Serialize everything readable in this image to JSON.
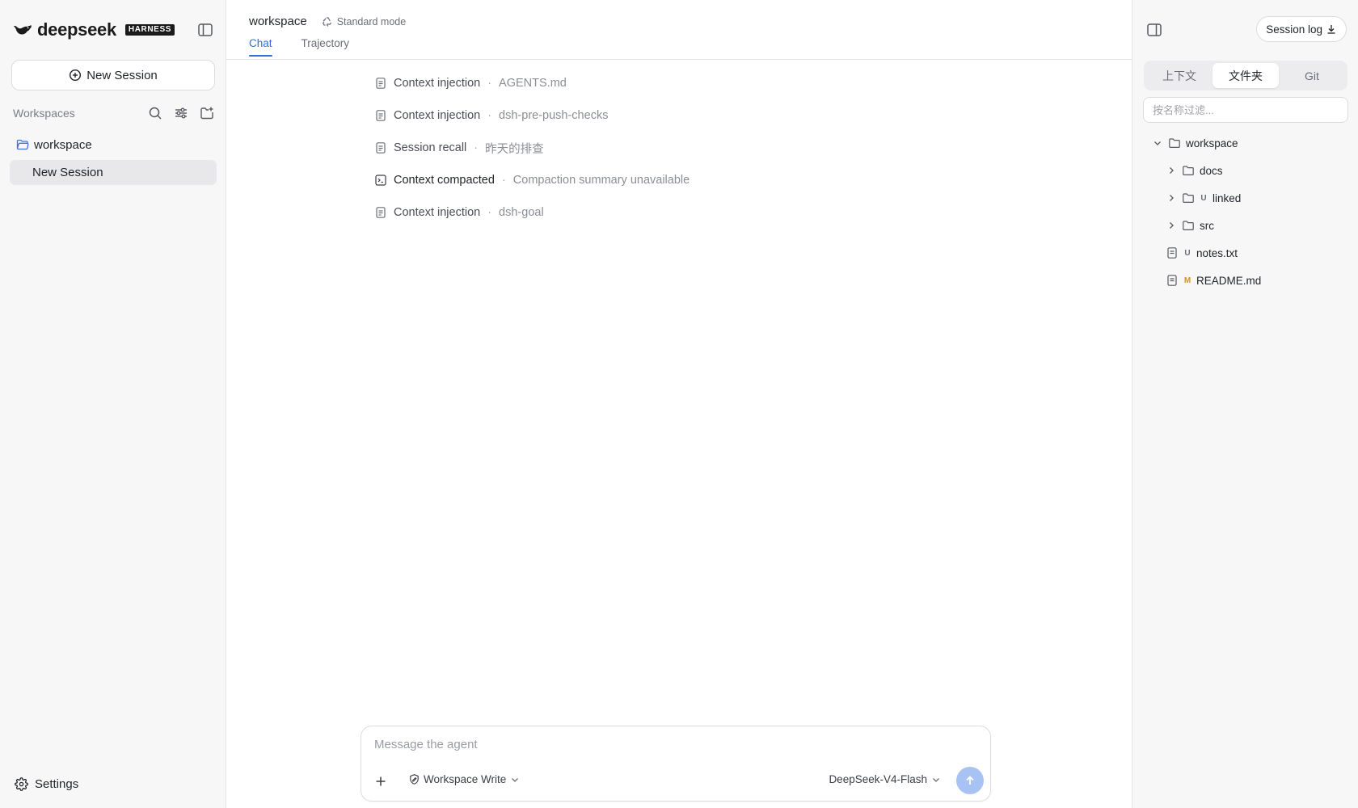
{
  "brand": {
    "name": "deepseek",
    "badge": "HARNESS"
  },
  "sidebar": {
    "new_session_label": "New Session",
    "workspaces_label": "Workspaces",
    "workspace_name": "workspace",
    "session_label": "New Session",
    "settings_label": "Settings"
  },
  "main": {
    "title": "workspace",
    "mode": "Standard mode",
    "tabs": [
      {
        "label": "Chat",
        "active": true
      },
      {
        "label": "Trajectory",
        "active": false
      }
    ],
    "events": [
      {
        "type": "Context injection",
        "detail": "AGENTS.md",
        "icon": "document-icon"
      },
      {
        "type": "Context injection",
        "detail": "dsh-pre-push-checks",
        "icon": "document-icon"
      },
      {
        "type": "Session recall",
        "detail": "昨天的排查",
        "icon": "document-icon"
      },
      {
        "type": "Context compacted",
        "detail": "Compaction summary unavailable",
        "icon": "terminal-icon"
      },
      {
        "type": "Context injection",
        "detail": "dsh-goal",
        "icon": "document-icon"
      }
    ],
    "separator": "·"
  },
  "composer": {
    "placeholder": "Message the agent",
    "permission": "Workspace Write",
    "model": "DeepSeek-V4-Flash"
  },
  "right_panel": {
    "session_log_label": "Session log",
    "tabs": [
      {
        "label": "上下文",
        "active": false
      },
      {
        "label": "文件夹",
        "active": true
      },
      {
        "label": "Git",
        "active": false
      }
    ],
    "filter_placeholder": "按名称过滤...",
    "tree": {
      "root": "workspace",
      "items": [
        {
          "name": "docs",
          "kind": "folder",
          "git": ""
        },
        {
          "name": "linked",
          "kind": "folder",
          "git": "U"
        },
        {
          "name": "src",
          "kind": "folder",
          "git": ""
        },
        {
          "name": "notes.txt",
          "kind": "file",
          "git": "U"
        },
        {
          "name": "README.md",
          "kind": "file",
          "git": "M"
        }
      ]
    }
  },
  "colors": {
    "accent": "#2f6fdf",
    "send_button": "#a9c2f4",
    "git_modified": "#d9901a",
    "sidebar_bg": "#f7f7f8"
  }
}
